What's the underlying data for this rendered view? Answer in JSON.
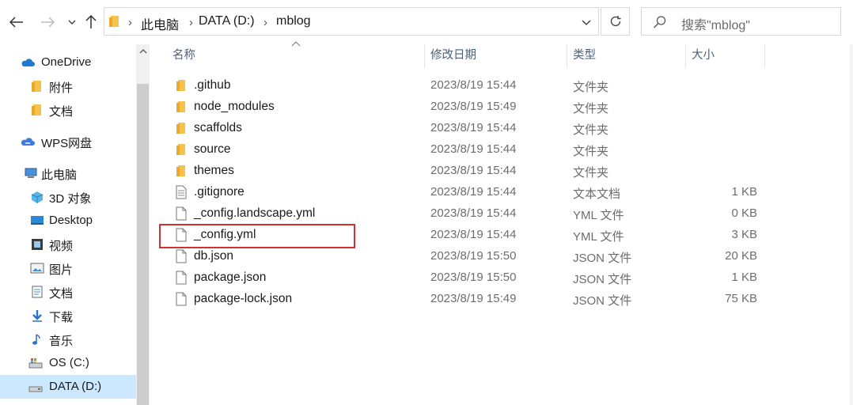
{
  "address": {
    "crumbs": [
      "此电脑",
      "DATA (D:)",
      "mblog"
    ]
  },
  "search": {
    "placeholder": "搜索\"mblog\""
  },
  "nav": {
    "items": [
      {
        "label": "OneDrive",
        "icon": "cloud-icon"
      },
      {
        "label": "附件",
        "icon": "folder-icon"
      },
      {
        "label": "文档",
        "icon": "folder-icon"
      },
      {
        "label": "WPS网盘",
        "icon": "wps-cloud-icon"
      },
      {
        "label": "此电脑",
        "icon": "computer-icon"
      },
      {
        "label": "3D 对象",
        "icon": "3d-objects-icon"
      },
      {
        "label": "Desktop",
        "icon": "desktop-icon"
      },
      {
        "label": "视频",
        "icon": "video-icon"
      },
      {
        "label": "图片",
        "icon": "pictures-icon"
      },
      {
        "label": "文档",
        "icon": "documents-icon"
      },
      {
        "label": "下载",
        "icon": "download-icon"
      },
      {
        "label": "音乐",
        "icon": "music-icon"
      },
      {
        "label": "OS (C:)",
        "icon": "drive-c-icon"
      },
      {
        "label": "DATA (D:)",
        "icon": "drive-d-icon"
      }
    ]
  },
  "columns": {
    "name": "名称",
    "date": "修改日期",
    "type": "类型",
    "size": "大小"
  },
  "files": [
    {
      "name": ".github",
      "date": "2023/8/19 15:44",
      "type": "文件夹",
      "size": "",
      "kind": "folder"
    },
    {
      "name": "node_modules",
      "date": "2023/8/19 15:49",
      "type": "文件夹",
      "size": "",
      "kind": "folder"
    },
    {
      "name": "scaffolds",
      "date": "2023/8/19 15:44",
      "type": "文件夹",
      "size": "",
      "kind": "folder"
    },
    {
      "name": "source",
      "date": "2023/8/19 15:44",
      "type": "文件夹",
      "size": "",
      "kind": "folder"
    },
    {
      "name": "themes",
      "date": "2023/8/19 15:44",
      "type": "文件夹",
      "size": "",
      "kind": "folder"
    },
    {
      "name": ".gitignore",
      "date": "2023/8/19 15:44",
      "type": "文本文档",
      "size": "1 KB",
      "kind": "text"
    },
    {
      "name": "_config.landscape.yml",
      "date": "2023/8/19 15:44",
      "type": "YML 文件",
      "size": "0 KB",
      "kind": "file"
    },
    {
      "name": "_config.yml",
      "date": "2023/8/19 15:44",
      "type": "YML 文件",
      "size": "3 KB",
      "kind": "file"
    },
    {
      "name": "db.json",
      "date": "2023/8/19 15:50",
      "type": "JSON 文件",
      "size": "20 KB",
      "kind": "file"
    },
    {
      "name": "package.json",
      "date": "2023/8/19 15:50",
      "type": "JSON 文件",
      "size": "1 KB",
      "kind": "file"
    },
    {
      "name": "package-lock.json",
      "date": "2023/8/19 15:49",
      "type": "JSON 文件",
      "size": "75 KB",
      "kind": "file"
    }
  ],
  "colors": {
    "folder": "#f6c24a",
    "selected": "#cce8ff",
    "highlight": "#d32f2f"
  }
}
